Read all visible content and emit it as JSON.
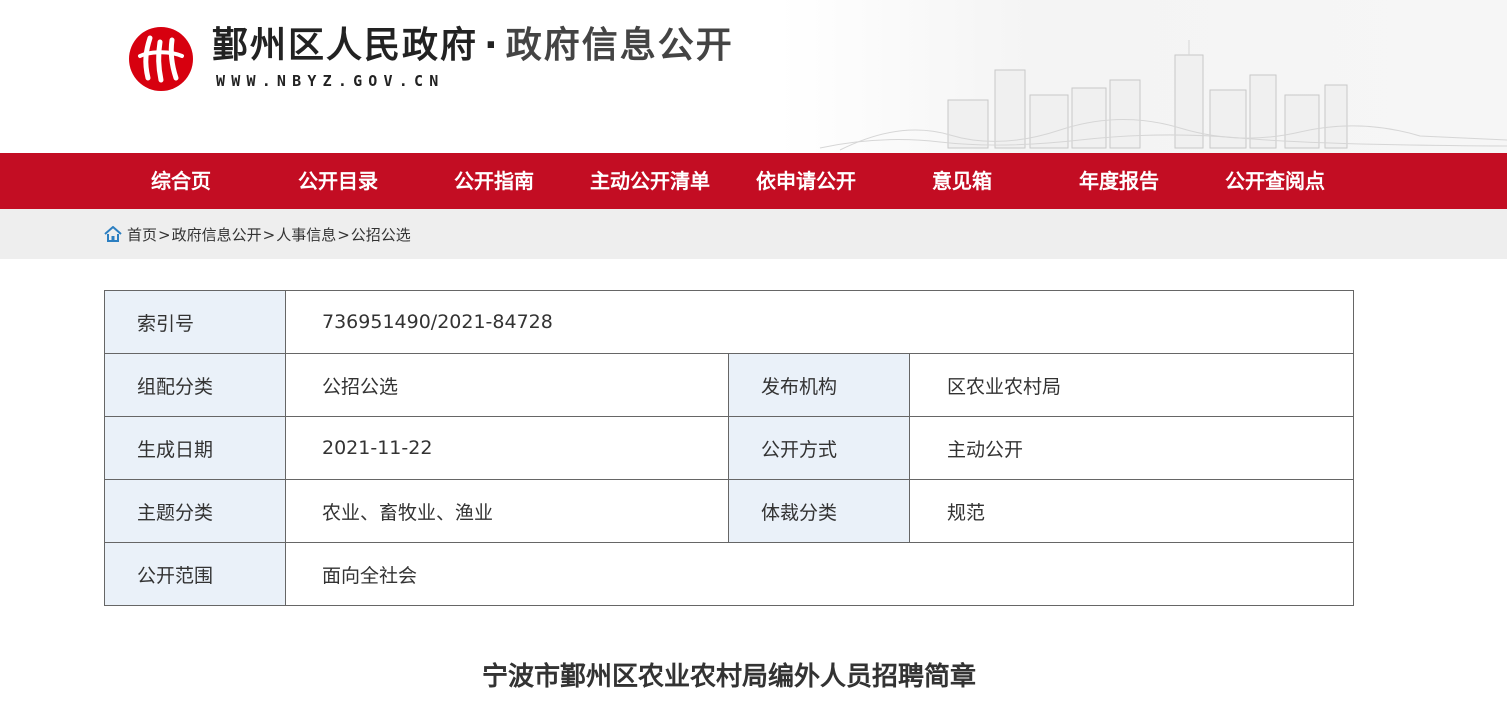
{
  "header": {
    "site_name": "鄞州区人民政府",
    "dot": "·",
    "site_sub": "政府信息公开",
    "url": "WWW.NBYZ.GOV.CN",
    "brand_color": "#c30d23"
  },
  "nav": {
    "items": [
      "综合页",
      "公开目录",
      "公开指南",
      "主动公开清单",
      "依申请公开",
      "意见箱",
      "年度报告",
      "公开查阅点"
    ]
  },
  "breadcrumb": {
    "icon": "home-icon",
    "items": [
      "首页",
      "政府信息公开",
      "人事信息",
      "公招公选"
    ],
    "separator": ">"
  },
  "meta": {
    "index_label": "索引号",
    "index_value": "736951490/2021-84728",
    "category_label": "组配分类",
    "category_value": "公招公选",
    "publisher_label": "发布机构",
    "publisher_value": "区农业农村局",
    "date_label": "生成日期",
    "date_value": "2021-11-22",
    "method_label": "公开方式",
    "method_value": "主动公开",
    "topic_label": "主题分类",
    "topic_value": "农业、畜牧业、渔业",
    "genre_label": "体裁分类",
    "genre_value": "规范",
    "scope_label": "公开范围",
    "scope_value": "面向全社会"
  },
  "document": {
    "title": "宁波市鄞州区农业农村局编外人员招聘简章"
  }
}
